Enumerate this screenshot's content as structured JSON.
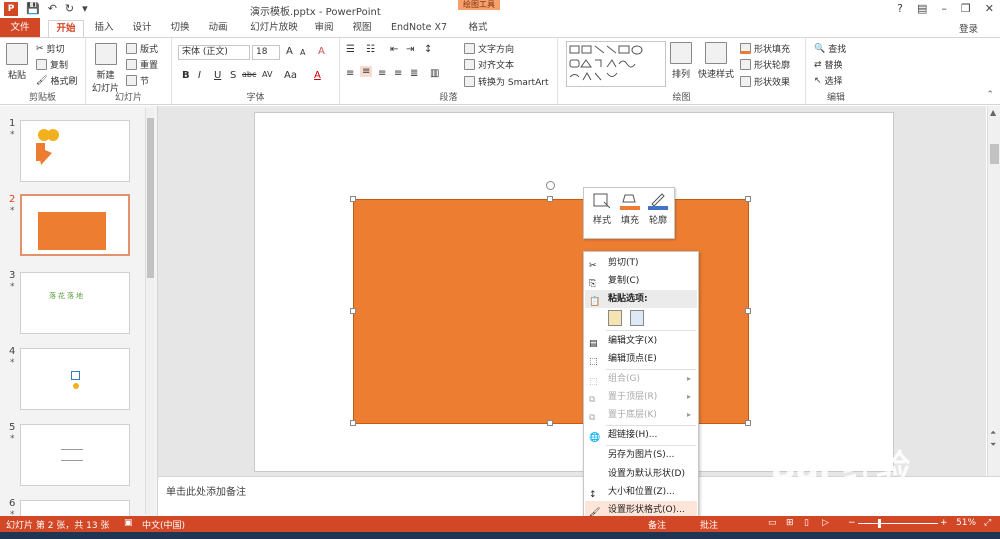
{
  "titlebar": {
    "app_badge": "P",
    "title": "演示模板.pptx - PowerPoint",
    "contextual_tools": "绘图工具",
    "minimize": "–",
    "restore": "❐",
    "close": "✕",
    "help": "?"
  },
  "tabs": {
    "file": "文件",
    "items": [
      "开始",
      "插入",
      "设计",
      "切换",
      "动画",
      "幻灯片放映",
      "审阅",
      "视图",
      "EndNote X7",
      "格式"
    ],
    "active": "开始",
    "login": "登录"
  },
  "ribbon": {
    "clipboard": {
      "paste": "粘贴",
      "cut": "剪切",
      "copy": "复制",
      "format_painter": "格式刷",
      "label": "剪贴板"
    },
    "slides": {
      "new_slide": "新建\n幻灯片",
      "layout": "版式",
      "reset": "重置",
      "section": "节",
      "label": "幻灯片"
    },
    "font": {
      "font_name": "宋体 (正文)",
      "font_size": "18",
      "bold": "B",
      "italic": "I",
      "underline": "U",
      "shadow": "S",
      "strike": "abc",
      "spacing": "AV",
      "case": "Aa",
      "color": "A",
      "grow": "A",
      "shrink": "A",
      "clear": "A",
      "label": "字体"
    },
    "paragraph": {
      "text_direction": "文字方向",
      "align_text": "对齐文本",
      "convert_smartart": "转换为 SmartArt",
      "label": "段落"
    },
    "drawing": {
      "arrange": "排列",
      "quick_styles": "快速样式",
      "shape_fill": "形状填充",
      "shape_outline": "形状轮廓",
      "shape_effects": "形状效果",
      "label": "绘图"
    },
    "editing": {
      "find": "查找",
      "replace": "替换",
      "select": "选择",
      "label": "编辑"
    }
  },
  "thumbnails": [
    {
      "num": "1",
      "star": "*"
    },
    {
      "num": "2",
      "star": "*"
    },
    {
      "num": "3",
      "star": "*",
      "text": "落花落地"
    },
    {
      "num": "4",
      "star": "*"
    },
    {
      "num": "5",
      "star": "*"
    },
    {
      "num": "6",
      "star": "*"
    }
  ],
  "mini_toolbar": {
    "style": "样式",
    "fill": "填充",
    "outline": "轮廓"
  },
  "context_menu": {
    "cut": "剪切(T)",
    "copy": "复制(C)",
    "paste_options": "粘贴选项:",
    "edit_text": "编辑文字(X)",
    "edit_points": "编辑顶点(E)",
    "group": "组合(G)",
    "bring_front": "置于顶层(R)",
    "send_back": "置于底层(K)",
    "hyperlink": "超链接(H)...",
    "save_as_picture": "另存为图片(S)...",
    "set_default": "设置为默认形状(D)",
    "size_position": "大小和位置(Z)...",
    "format_shape": "设置形状格式(O)..."
  },
  "notes": {
    "placeholder": "单击此处添加备注"
  },
  "statusbar": {
    "slide_info": "幻灯片 第 2 张，共 13 张",
    "language": "中文(中国)",
    "notes": "备注",
    "comments": "批注",
    "zoom": "51%"
  },
  "watermark": {
    "logo": "Bai 经验",
    "url": "jingyan.baidu.com"
  },
  "colors": {
    "accent": "#d24726",
    "shape_fill": "#ed7d31"
  }
}
